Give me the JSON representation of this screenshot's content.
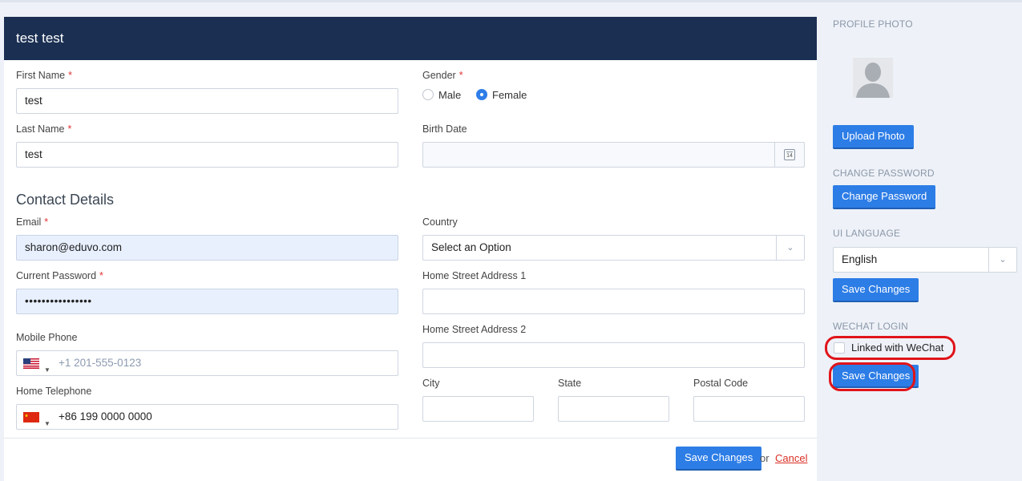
{
  "header": {
    "title": "test test"
  },
  "form": {
    "first_name": {
      "label": "First Name",
      "required": "*",
      "value": "test"
    },
    "last_name": {
      "label": "Last Name",
      "required": "*",
      "value": "test"
    },
    "gender": {
      "label": "Gender",
      "required": "*",
      "options": [
        "Male",
        "Female"
      ],
      "selected": "Female"
    },
    "birth_date": {
      "label": "Birth Date",
      "value": "",
      "calendar_day": "14"
    },
    "contact_title": "Contact Details",
    "email": {
      "label": "Email",
      "required": "*",
      "value": "sharon@eduvo.com"
    },
    "current_password": {
      "label": "Current Password",
      "required": "*",
      "value": "••••••••••••••••"
    },
    "mobile_phone": {
      "label": "Mobile Phone",
      "placeholder": "+1 201-555-0123"
    },
    "home_telephone": {
      "label": "Home Telephone",
      "value": "+86 199 0000 0000"
    },
    "country": {
      "label": "Country",
      "value": "Select an Option"
    },
    "home_street_1": {
      "label": "Home Street Address 1",
      "value": ""
    },
    "home_street_2": {
      "label": "Home Street Address 2",
      "value": ""
    },
    "city": {
      "label": "City",
      "value": ""
    },
    "state": {
      "label": "State",
      "value": ""
    },
    "postal_code": {
      "label": "Postal Code",
      "value": ""
    }
  },
  "footer": {
    "save_label": "Save Changes",
    "or_text": "or",
    "cancel_label": "Cancel"
  },
  "sidebar": {
    "profile_photo_heading": "PROFILE PHOTO",
    "upload_label": "Upload Photo",
    "change_password_heading": "CHANGE PASSWORD",
    "change_password_label": "Change Password",
    "ui_language_heading": "UI LANGUAGE",
    "language_value": "English",
    "language_save_label": "Save Changes",
    "wechat_heading": "WECHAT LOGIN",
    "wechat_checkbox_label": "Linked with WeChat",
    "wechat_save_label": "Save Changes"
  },
  "colors": {
    "header_bg": "#1a2f52",
    "accent": "#2d7de6",
    "highlight": "#e0141a",
    "required": "#e03434"
  }
}
